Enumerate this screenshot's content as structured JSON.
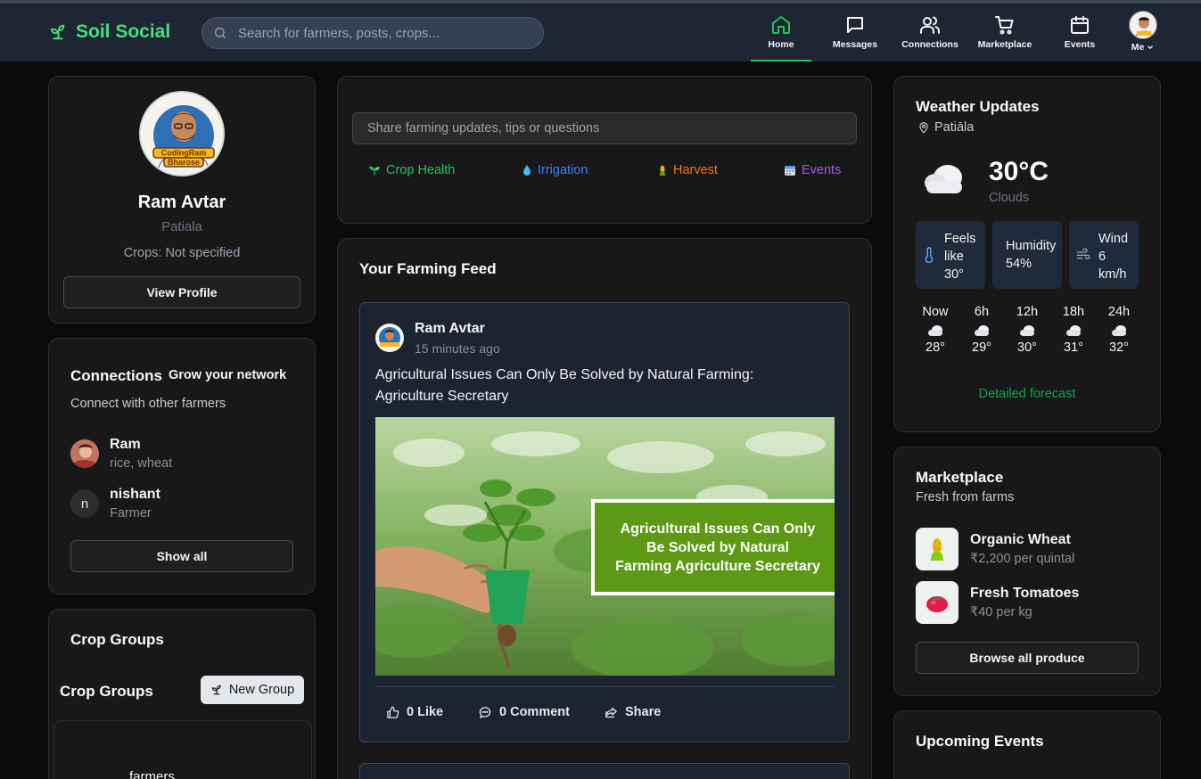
{
  "nav": {
    "brand": "Soil Social",
    "search_placeholder": "Search for farmers, posts, crops...",
    "items": [
      {
        "label": "Home",
        "icon": "home-icon"
      },
      {
        "label": "Messages",
        "icon": "message-icon"
      },
      {
        "label": "Connections",
        "icon": "users-icon"
      },
      {
        "label": "Marketplace",
        "icon": "cart-icon"
      },
      {
        "label": "Events",
        "icon": "calendar-icon"
      },
      {
        "label": "Me",
        "icon": "chevron-down-icon"
      }
    ],
    "active": "Home",
    "accent": "#22c55e"
  },
  "profile": {
    "avatar_text": [
      "CodingRam",
      "Bharose"
    ],
    "name": "Ram Avtar",
    "location": "Patiala",
    "crops": "Crops: Not specified",
    "view_button": "View Profile"
  },
  "connections": {
    "title": "Connections",
    "subtitle_link": "Grow your network",
    "description": "Connect with other farmers",
    "people": [
      {
        "name": "Ram",
        "detail": "rice, wheat",
        "initial": ""
      },
      {
        "name": "nishant",
        "detail": "Farmer",
        "initial": "n"
      }
    ],
    "show_all": "Show all"
  },
  "crop_groups": {
    "card_title": "Crop Groups",
    "section_title": "Crop Groups",
    "new_group_button": "New Group",
    "group_preview_text": "farmers"
  },
  "composer": {
    "placeholder": "Share farming updates, tips or questions",
    "chips": [
      {
        "label": "Crop Health",
        "color": "#22c55e",
        "icon": "sprout-icon"
      },
      {
        "label": "Irrigation",
        "color": "#3b82f6",
        "icon": "droplet-icon"
      },
      {
        "label": "Harvest",
        "color": "#f97316",
        "icon": "corn-icon"
      },
      {
        "label": "Events",
        "color": "#a855f7",
        "icon": "calendar-icon"
      }
    ]
  },
  "feed": {
    "title": "Your Farming Feed",
    "post": {
      "author": "Ram Avtar",
      "time": "15 minutes ago",
      "text": "Agricultural Issues Can Only Be Solved by Natural Farming: Agriculture Secretary",
      "image_banner": [
        "Agricultural Issues Can Only",
        "Be Solved by Natural",
        "Farming Agriculture Secretary"
      ],
      "like": "0 Like",
      "comment": "0 Comment",
      "share": "Share"
    }
  },
  "weather": {
    "title": "Weather Updates",
    "location": "Patiāla",
    "temp": "30°C",
    "condition": "Clouds",
    "feels_like": [
      "Feels",
      "like",
      "30°"
    ],
    "humidity": [
      "Humidity",
      "54%"
    ],
    "wind": [
      "Wind",
      "6",
      "km/h"
    ],
    "forecast": [
      {
        "time": "Now",
        "temp": "28°"
      },
      {
        "time": "6h",
        "temp": "29°"
      },
      {
        "time": "12h",
        "temp": "30°"
      },
      {
        "time": "18h",
        "temp": "31°"
      },
      {
        "time": "24h",
        "temp": "32°"
      }
    ],
    "detail_link": "Detailed forecast"
  },
  "marketplace": {
    "title": "Marketplace",
    "subtitle": "Fresh from farms",
    "items": [
      {
        "name": "Organic Wheat",
        "price": "₹2,200 per quintal",
        "icon": "wheat-icon"
      },
      {
        "name": "Fresh Tomatoes",
        "price": "₹40 per kg",
        "icon": "tomato-icon"
      }
    ],
    "browse_button": "Browse all produce"
  },
  "events": {
    "title": "Upcoming Events"
  }
}
